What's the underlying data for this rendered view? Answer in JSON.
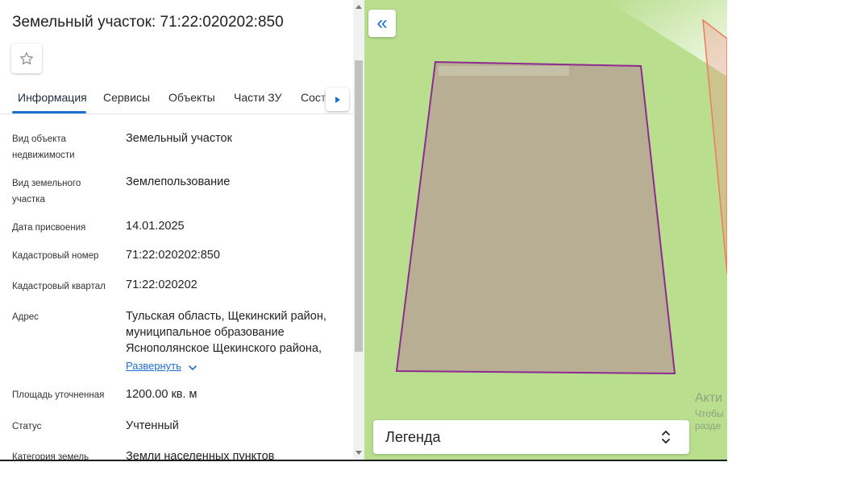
{
  "panel": {
    "title": "Земельный участок: 71:22:020202:850",
    "tabs": [
      {
        "label": "Информация"
      },
      {
        "label": "Сервисы"
      },
      {
        "label": "Объекты"
      },
      {
        "label": "Части ЗУ"
      },
      {
        "label": "Состав"
      }
    ],
    "active_tab": "Информация",
    "rows": [
      {
        "label": "Вид объекта недвижимости",
        "value": "Земельный участок"
      },
      {
        "label": "Вид земельного участка",
        "value": "Землепользование"
      },
      {
        "label": "Дата присвоения",
        "value": "14.01.2025"
      },
      {
        "label": "Кадастровый номер",
        "value": "71:22:020202:850"
      },
      {
        "label": "Кадастровый квартал",
        "value": "71:22:020202"
      },
      {
        "label": "Адрес",
        "value": "Тульская область, Щекинский район, муниципальное образование Яснополянское Щекинского района,"
      },
      {
        "label": "Площадь уточненная",
        "value": "1200.00 кв. м"
      },
      {
        "label": "Статус",
        "value": "Учтенный"
      },
      {
        "label": "Категория земель",
        "value": "Земли населенных пунктов"
      }
    ],
    "expand_label": "Развернуть"
  },
  "map": {
    "legend_label": "Легенда",
    "watermark": {
      "line1": "Акти",
      "line2": "Чтобы",
      "line3": "разде"
    }
  },
  "icons": {
    "favorite": "star-outline-icon",
    "tabs_scroll": "triangle-right-icon",
    "expand": "chevron-down-icon",
    "collapse_panel": "double-chevron-left-icon",
    "legend_toggle": "chevron-up-down-icon"
  },
  "colors": {
    "accent": "#1f6fd1",
    "map_background": "#b9de8e",
    "parcel_fill": "#b8ae93",
    "parcel_border": "#8e2a91",
    "neighbor_border": "#f07a5a"
  }
}
